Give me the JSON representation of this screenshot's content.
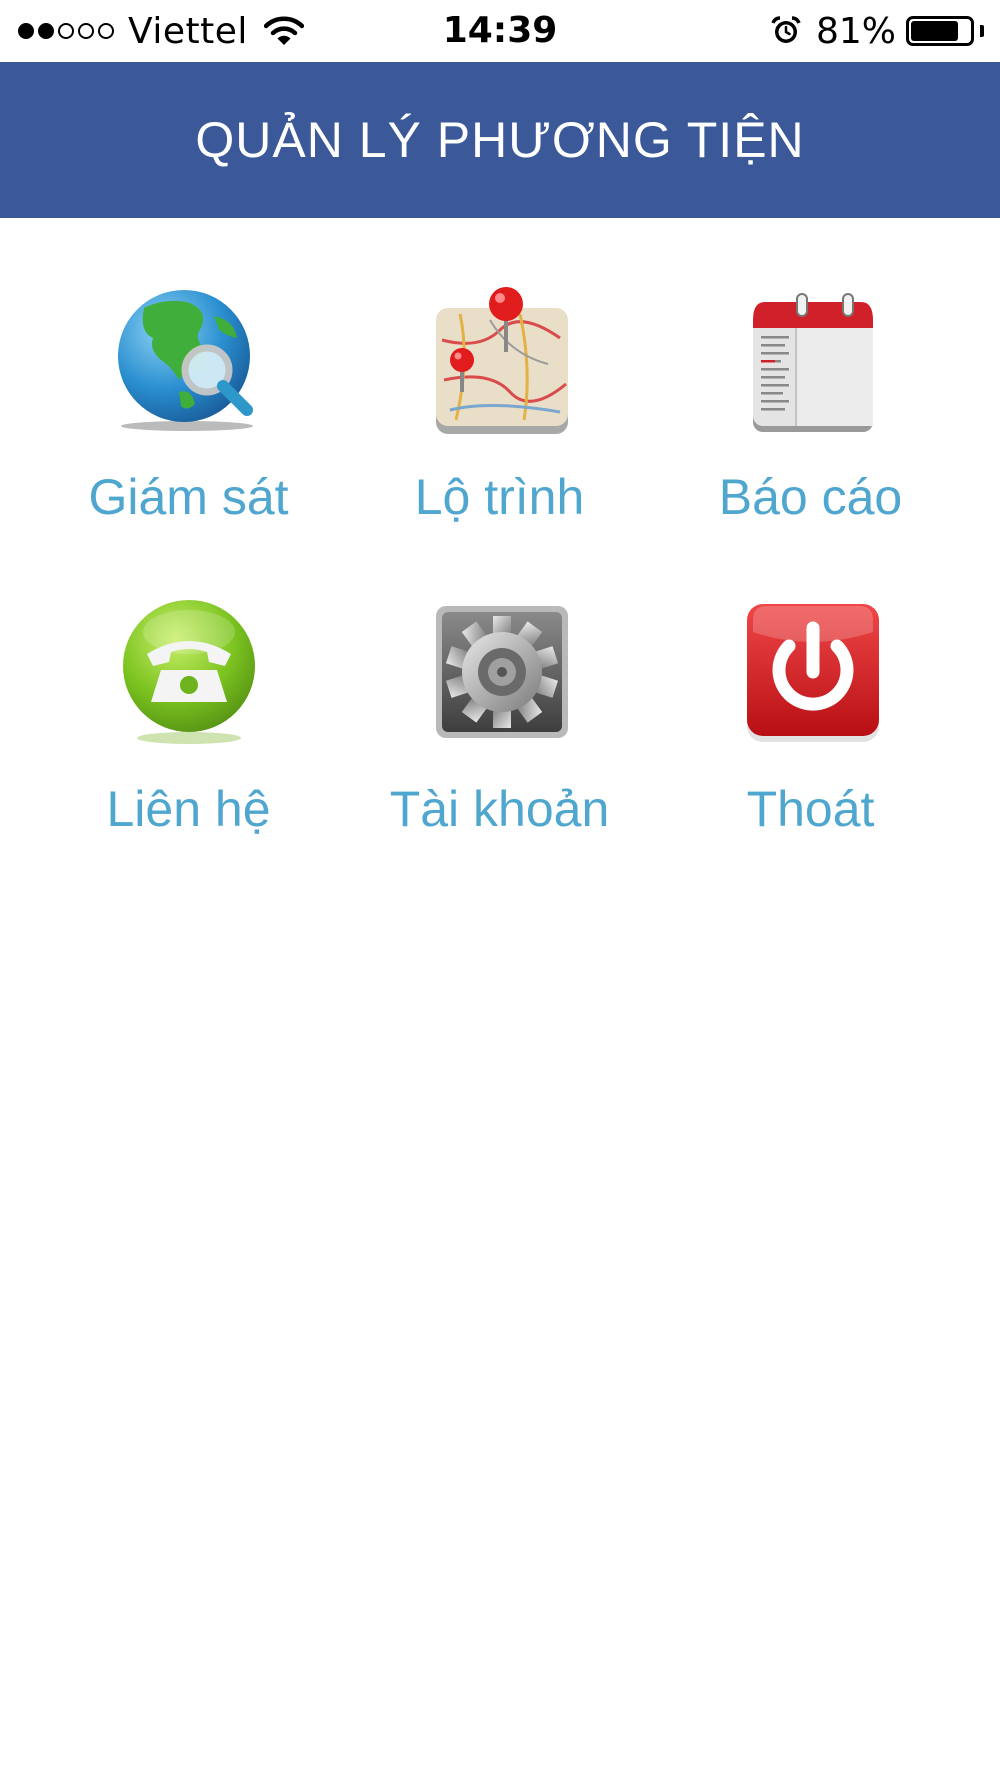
{
  "status_bar": {
    "carrier": "Viettel",
    "signal_bars_filled": 2,
    "signal_bars_total": 5,
    "time": "14:39",
    "battery_percent_label": "81%",
    "battery_level": 0.81,
    "icons": [
      "wifi-icon",
      "alarm-icon",
      "battery-icon"
    ]
  },
  "header": {
    "title": "QUẢN LÝ PHƯƠNG TIỆN",
    "background_color": "#3b5998"
  },
  "menu": {
    "label_color": "#4fa6cf",
    "items": [
      {
        "label": "Giám sát",
        "icon": "globe-search-icon"
      },
      {
        "label": "Lộ trình",
        "icon": "map-pins-icon"
      },
      {
        "label": "Báo cáo",
        "icon": "calendar-report-icon"
      },
      {
        "label": "Liên hệ",
        "icon": "phone-icon"
      },
      {
        "label": "Tài khoản",
        "icon": "gear-icon"
      },
      {
        "label": "Thoát",
        "icon": "power-icon"
      }
    ]
  }
}
